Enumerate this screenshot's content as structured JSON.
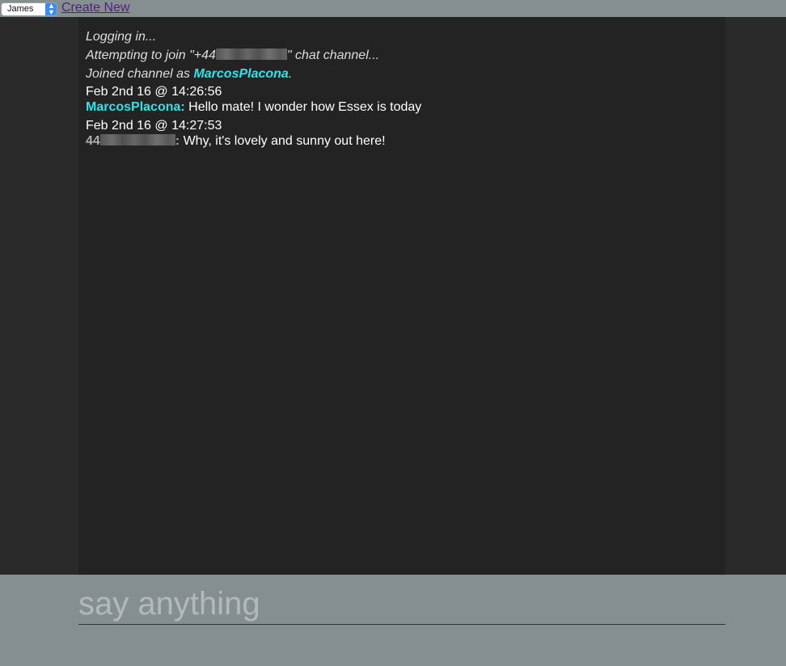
{
  "topbar": {
    "selected_user": "James",
    "create_new_label": "Create New"
  },
  "chat": {
    "system": {
      "logging_in": "Logging in...",
      "attempting_prefix": "Attempting to join \"+44",
      "attempting_suffix": "\" chat channel...",
      "joined_prefix": "Joined channel as ",
      "joined_name": "MarcosPlacona",
      "joined_suffix": "."
    },
    "messages": [
      {
        "timestamp": "Feb 2nd 16 @ 14:26:56",
        "author": "MarcosPlacona",
        "author_suffix": ":",
        "text": " Hello mate! I wonder how Essex is today"
      },
      {
        "timestamp": "Feb 2nd 16 @ 14:27:53",
        "author": "44",
        "author_suffix": ":",
        "text": " Why, it's lovely and sunny out here!"
      }
    ]
  },
  "composer": {
    "placeholder": "say anything"
  },
  "colors": {
    "page_bg": "#2a2a2a",
    "chat_bg": "#232323",
    "bar_bg": "#858f8f",
    "accent_name": "#2fe3e8"
  }
}
